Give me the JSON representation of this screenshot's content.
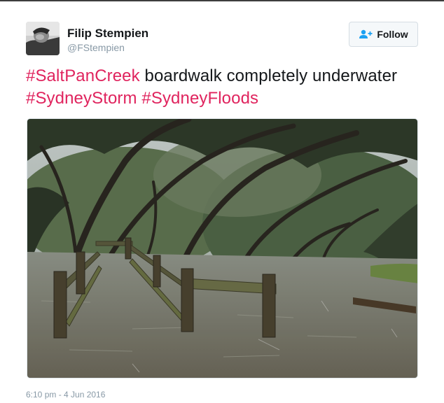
{
  "author": {
    "display_name": "Filip Stempien",
    "handle": "@FStempien"
  },
  "follow_button": {
    "label": "Follow",
    "icon": "add-person-icon"
  },
  "tweet": {
    "segments": [
      {
        "text": "#SaltPanCreek",
        "type": "hashtag"
      },
      {
        "text": " boardwalk completely underwater ",
        "type": "text"
      },
      {
        "text": "#SydneyStorm",
        "type": "hashtag"
      },
      {
        "text": " ",
        "type": "text"
      },
      {
        "text": "#SydneyFloods",
        "type": "hashtag"
      }
    ],
    "timestamp": "6:10 pm - 4 Jun 2016"
  },
  "colors": {
    "hashtag": "#e0245e",
    "follow_icon": "#1da1f2",
    "muted_text": "#8899a6"
  }
}
